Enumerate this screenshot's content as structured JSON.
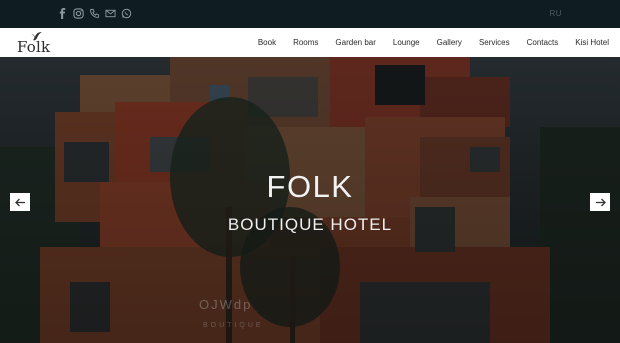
{
  "topbar": {
    "socials": [
      "facebook-icon",
      "instagram-icon",
      "phone-icon",
      "mail-icon",
      "whatsapp-icon"
    ],
    "language": "RU"
  },
  "brand": {
    "logo_text": "Folk"
  },
  "nav": {
    "items": [
      "Book",
      "Rooms",
      "Garden bar",
      "Lounge",
      "Gallery",
      "Services",
      "Contacts",
      "Kisi Hotel"
    ]
  },
  "hero": {
    "title": "FOLK",
    "subtitle": "BOUTIQUE HOTEL",
    "sign_text": "OJWdp",
    "sign_subtext": "BOUTIQUE"
  },
  "colors": {
    "topbar": "#0f1d22",
    "nav_bg": "#ffffff",
    "icon": "#8a9aa0",
    "rust": "#7a3322"
  }
}
